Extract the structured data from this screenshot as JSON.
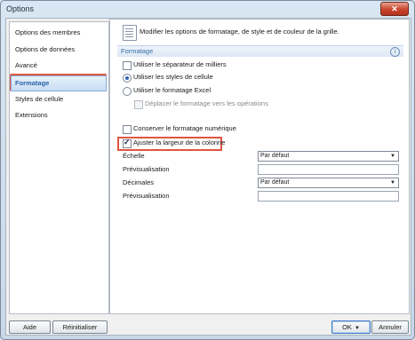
{
  "window": {
    "title": "Options",
    "close_label": "✕"
  },
  "sidebar": {
    "items": [
      {
        "label": "Options des membres"
      },
      {
        "label": "Options de données"
      },
      {
        "label": "Avancé"
      },
      {
        "label": "Formatage"
      },
      {
        "label": "Styles de cellule"
      },
      {
        "label": "Extensions"
      }
    ],
    "selected": "Formatage"
  },
  "content": {
    "header": "Modifier les options de formatage, de style et de couleur de la grille.",
    "section_title": "Formatage",
    "options": {
      "thousands_separator": {
        "label": "Utiliser le séparateur de milliers",
        "checked": false
      },
      "cell_styles": {
        "label": "Utiliser les styles de cellule",
        "selected": true
      },
      "excel_format": {
        "label": "Utiliser le formatage Excel",
        "selected": false
      },
      "move_format_ops": {
        "label": "Déplacer le formatage vers les opérations",
        "checked": false,
        "enabled": false
      },
      "keep_numeric": {
        "label": "Conserver le formatage numérique",
        "checked": false
      },
      "adjust_width": {
        "label": "Ajuster la largeur de la colonne",
        "checked": true
      }
    },
    "scale": {
      "label": "Échelle",
      "value": "Par défaut"
    },
    "preview1": {
      "label": "Prévisualisation",
      "value": ""
    },
    "decimals": {
      "label": "Décimales",
      "value": "Par défaut"
    },
    "preview2": {
      "label": "Prévisualisation",
      "value": ""
    }
  },
  "footer": {
    "help": "Aide",
    "reset": "Réinitialiser",
    "ok": "OK",
    "cancel": "Annuler"
  }
}
